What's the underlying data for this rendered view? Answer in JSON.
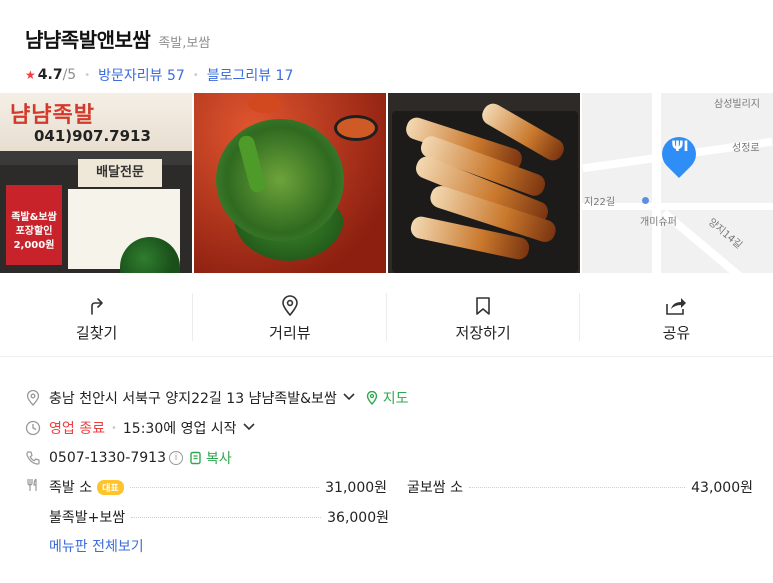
{
  "place": {
    "name": "냠냠족발앤보쌈",
    "category": "족발,보쌈",
    "rating": "4.7",
    "rating_max": "/5",
    "visitor_reviews": "방문자리뷰 57",
    "blog_reviews": "블로그리뷰 17"
  },
  "photos": {
    "storefront_sign": "냠냠족발",
    "storefront_phone": "041)907.7913",
    "storefront_menu": "배달전문",
    "storefront_panel": "족발&보쌈 포장할인 2,000원",
    "map_labels": [
      "삼성빌리지",
      "성정로",
      "지22길",
      "개미슈퍼",
      "양지14길"
    ]
  },
  "actions": {
    "directions": "길찾기",
    "street_view": "거리뷰",
    "save": "저장하기",
    "share": "공유"
  },
  "info": {
    "address": "충남 천안시 서북구 양지22길 13 냠냠족발&보쌈",
    "map_link": "지도",
    "status": "영업 종료",
    "status_detail": "15:30에 영업 시작",
    "phone": "0507-1330-7913",
    "copy": "복사"
  },
  "menu": {
    "items": [
      {
        "name": "족발 소",
        "badge": "대표",
        "price": "31,000원"
      },
      {
        "name": "굴보쌈 소",
        "price": "43,000원"
      },
      {
        "name": "불족발+보쌈",
        "price": "36,000원"
      }
    ],
    "view_all": "메뉴판 전체보기"
  },
  "colors": {
    "link_blue": "#3c6cdc",
    "green": "#2fa84f",
    "red": "#f03e3e",
    "badge_yellow": "#ffc32b",
    "pin_blue": "#2f8ef6"
  }
}
